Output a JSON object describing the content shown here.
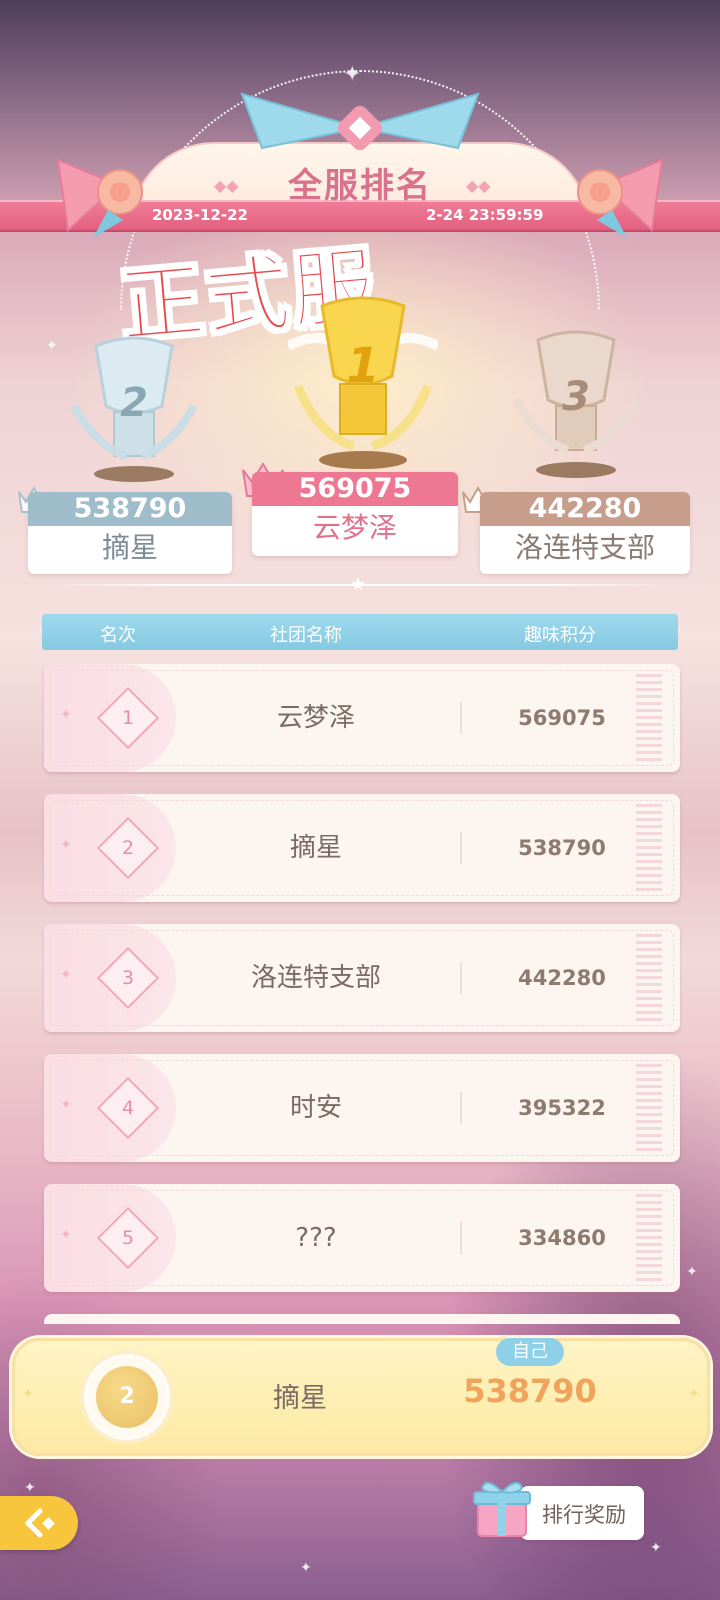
{
  "banner": {
    "title": "全服排名",
    "date_start": "2023-12-22",
    "date_end": "2-24 23:59:59",
    "stamp": "正式服"
  },
  "podium": [
    {
      "place": "2",
      "score": "538790",
      "club": "摘星",
      "color": "#9fbccb"
    },
    {
      "place": "1",
      "score": "569075",
      "club": "云梦泽",
      "color": "#ee7893"
    },
    {
      "place": "3",
      "score": "442280",
      "club": "洛连特支部",
      "color": "#c79e8c"
    }
  ],
  "table": {
    "headers": [
      "名次",
      "社团名称",
      "趣味积分"
    ],
    "rows": [
      {
        "rank": "1",
        "club": "云梦泽",
        "points": "569075"
      },
      {
        "rank": "2",
        "club": "摘星",
        "points": "538790"
      },
      {
        "rank": "3",
        "club": "洛连特支部",
        "points": "442280"
      },
      {
        "rank": "4",
        "club": "时安",
        "points": "395322"
      },
      {
        "rank": "5",
        "club": "???",
        "points": "334860"
      }
    ]
  },
  "self": {
    "tag": "自己",
    "rank": "2",
    "club": "摘星",
    "points": "538790"
  },
  "controls": {
    "reward_label": "排行奖励",
    "back_icon": "back-arrow-icon",
    "gift_icon": "gift-box-icon"
  },
  "colors": {
    "accent_pink": "#ee7893",
    "self_points": "#f0a45b",
    "header_blue": "#8ed0e8",
    "stamp_red": "#e8494e"
  }
}
